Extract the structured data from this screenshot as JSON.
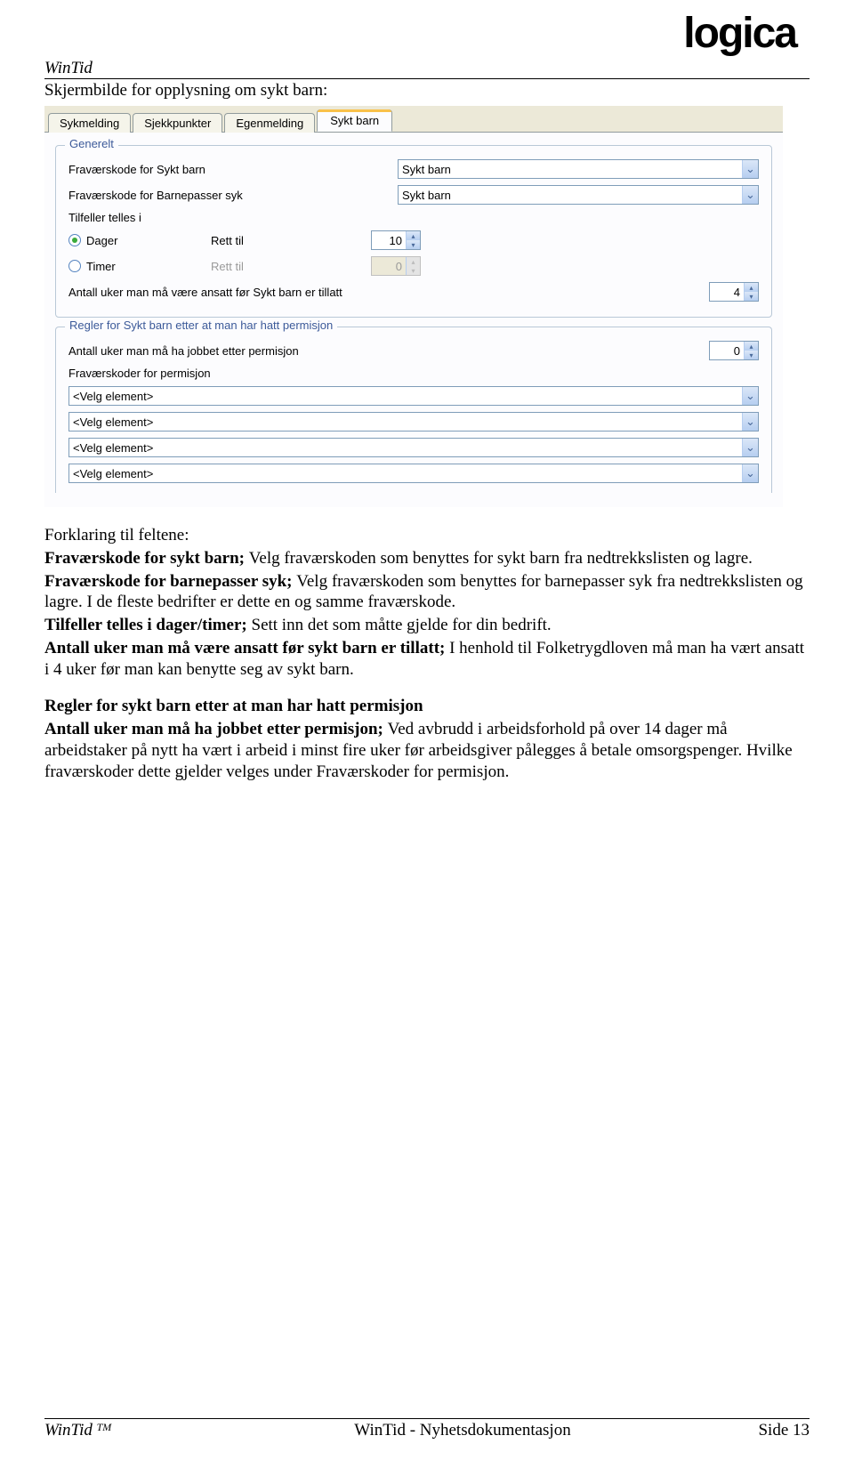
{
  "header": {
    "app": "WinTid"
  },
  "logo_text": "logica",
  "caption": "Skjermbilde for opplysning om sykt barn:",
  "ui": {
    "tabs": [
      "Sykmelding",
      "Sjekkpunkter",
      "Egenmelding",
      "Sykt barn"
    ],
    "active_tab_index": 3,
    "group1": {
      "title": "Generelt",
      "code_sick_child_label": "Fraværskode for Sykt barn",
      "code_sick_child_value": "Sykt barn",
      "code_sitter_label": "Fraværskode for Barnepasser syk",
      "code_sitter_value": "Sykt barn",
      "count_in_label": "Tilfeller telles i",
      "opt_days": "Dager",
      "opt_hours": "Timer",
      "right_to": "Rett til",
      "right_to_disabled": "Rett til",
      "days_value": "10",
      "hours_value": "0",
      "weeks_before_label": "Antall uker man må være ansatt før Sykt barn er tillatt",
      "weeks_before_value": "4"
    },
    "group2": {
      "title": "Regler for Sykt barn etter at man har hatt permisjon",
      "weeks_after_label": "Antall uker man må ha jobbet etter permisjon",
      "weeks_after_value": "0",
      "perm_codes_label": "Fraværskoder for permisjon",
      "placeholder": "<Velg element>"
    }
  },
  "text": {
    "forklaring_title": "Forklaring til feltene:",
    "p1_lead": "Fraværskode for sykt barn; ",
    "p1_rest": "Velg fraværskoden som benyttes for sykt barn fra nedtrekkslisten og lagre.",
    "p2_lead": "Fraværskode for barnepasser syk; ",
    "p2_rest": "Velg fraværskoden som benyttes for barnepasser syk fra nedtrekkslisten og lagre. I de fleste bedrifter er dette en og samme fraværskode.",
    "p3_lead": "Tilfeller telles i dager/timer; ",
    "p3_rest": "Sett inn det som måtte gjelde for din bedrift.",
    "p4_lead": "Antall uker man må være ansatt før sykt barn er tillatt; ",
    "p4_rest": "I henhold til Folketrygdloven må man ha vært ansatt i 4 uker før man kan benytte seg av sykt barn.",
    "sec2_title": "Regler for sykt barn etter at man har hatt permisjon",
    "p5_lead": "Antall uker man må ha jobbet etter permisjon; ",
    "p5_rest": "Ved avbrudd i arbeidsforhold på over 14 dager må arbeidstaker på nytt ha vært i arbeid i minst fire uker før arbeidsgiver pålegges å betale omsorgspenger. Hvilke fraværskoder dette gjelder velges under Fraværskoder for permisjon."
  },
  "footer": {
    "left": "WinTid ",
    "tm": "TM",
    "center": "WinTid - Nyhetsdokumentasjon",
    "right": "Side 13"
  }
}
